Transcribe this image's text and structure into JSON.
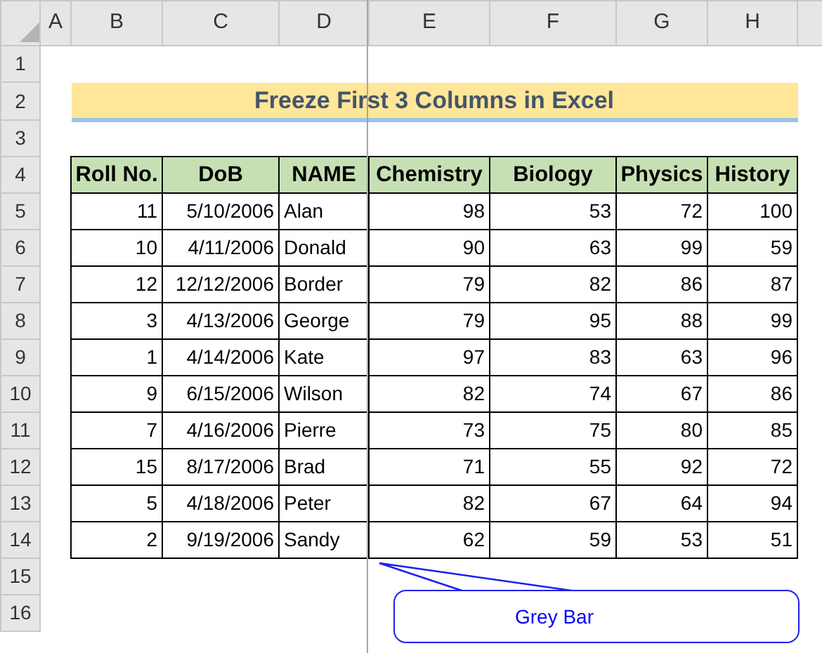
{
  "column_headers": [
    "A",
    "B",
    "C",
    "D",
    "E",
    "F",
    "G",
    "H"
  ],
  "row_headers": [
    "1",
    "2",
    "3",
    "4",
    "5",
    "6",
    "7",
    "8",
    "9",
    "10",
    "11",
    "12",
    "13",
    "14",
    "15",
    "16"
  ],
  "title": "Freeze First 3 Columns in Excel",
  "table": {
    "columns": [
      "Roll No.",
      "DoB",
      "NAME",
      "Chemistry",
      "Biology",
      "Physics",
      "History"
    ],
    "rows": [
      [
        "11",
        "5/10/2006",
        "Alan",
        "98",
        "53",
        "72",
        "100"
      ],
      [
        "10",
        "4/11/2006",
        "Donald",
        "90",
        "63",
        "99",
        "59"
      ],
      [
        "12",
        "12/12/2006",
        "Border",
        "79",
        "82",
        "86",
        "87"
      ],
      [
        "3",
        "4/13/2006",
        "George",
        "79",
        "95",
        "88",
        "99"
      ],
      [
        "1",
        "4/14/2006",
        "Kate",
        "97",
        "83",
        "63",
        "96"
      ],
      [
        "9",
        "6/15/2006",
        "Wilson",
        "82",
        "74",
        "67",
        "86"
      ],
      [
        "7",
        "4/16/2006",
        "Pierre",
        "73",
        "75",
        "80",
        "85"
      ],
      [
        "15",
        "8/17/2006",
        "Brad",
        "71",
        "55",
        "92",
        "72"
      ],
      [
        "5",
        "4/18/2006",
        "Peter",
        "82",
        "67",
        "64",
        "94"
      ],
      [
        "2",
        "9/19/2006",
        "Sandy",
        "62",
        "59",
        "53",
        "51"
      ]
    ]
  },
  "callout": {
    "text": "Grey Bar"
  }
}
